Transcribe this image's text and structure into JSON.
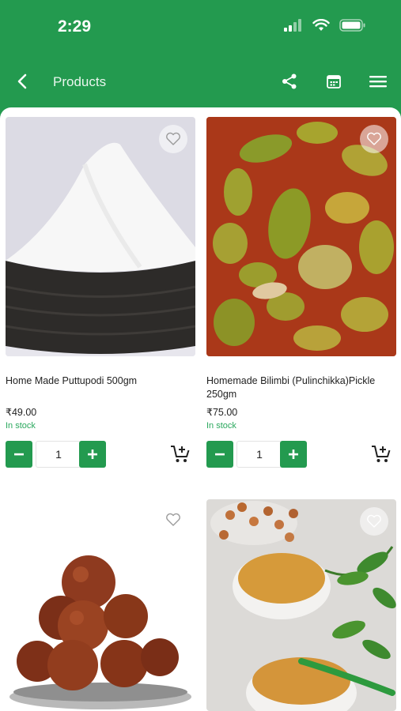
{
  "status_bar": {
    "time": "2:29"
  },
  "header": {
    "title": "Products"
  },
  "products": [
    {
      "name": "Home Made Puttupodi  500gm",
      "price": "₹49.00",
      "stock": "In stock",
      "qty": "1"
    },
    {
      "name": "Homemade Bilimbi (Pulinchikka)Pickle 250gm",
      "price": "₹75.00",
      "stock": "In stock",
      "qty": "1"
    },
    {
      "name": "",
      "price": "",
      "stock": "",
      "qty": ""
    },
    {
      "name": "",
      "price": "",
      "stock": "",
      "qty": ""
    }
  ],
  "colors": {
    "brand": "#239a4f",
    "stock": "#2aa85d"
  },
  "icons": [
    "back-icon",
    "share-icon",
    "calendar-icon",
    "menu-icon",
    "heart-icon",
    "minus-icon",
    "plus-icon",
    "add-to-cart-icon"
  ]
}
